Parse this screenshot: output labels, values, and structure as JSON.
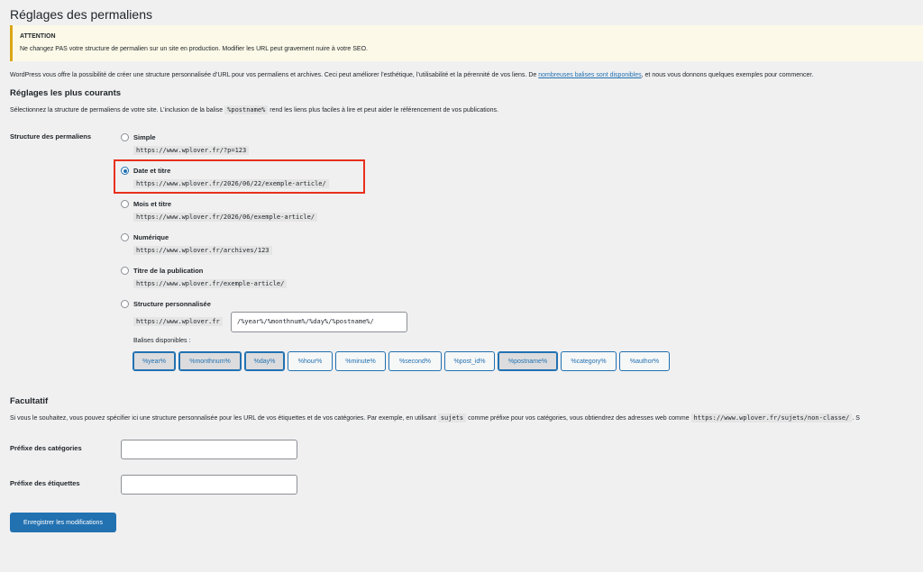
{
  "page": {
    "title": "Réglages des permaliens",
    "notice_title": "ATTENTION",
    "notice_text": "Ne changez PAS votre structure de permalien sur un site en production. Modifier les URL peut gravement nuire à votre SEO.",
    "intro_before": "WordPress vous offre la possibilité de créer une structure personnalisée d’URL pour vos permaliens et archives. Ceci peut améliorer l’esthétique, l’utilisabilité et la pérennité de vos liens. De ",
    "intro_link": "nombreuses balises sont disponibles",
    "intro_after": ", et nous vous donnons quelques exemples pour commencer."
  },
  "common": {
    "heading": "Réglages les plus courants",
    "desc_before": "Sélectionnez la structure de permaliens de votre site. L’inclusion de la balise ",
    "desc_code": "%postname%",
    "desc_after": " rend les liens plus faciles à lire et peut aider le référencement de vos publications.",
    "structure_label": "Structure des permaliens",
    "options": [
      {
        "label": "Simple",
        "example": "https://www.wplover.fr/?p=123"
      },
      {
        "label": "Date et titre",
        "example": "https://www.wplover.fr/2026/06/22/exemple-article/"
      },
      {
        "label": "Mois et titre",
        "example": "https://www.wplover.fr/2026/06/exemple-article/"
      },
      {
        "label": "Numérique",
        "example": "https://www.wplover.fr/archives/123"
      },
      {
        "label": "Titre de la publication",
        "example": "https://www.wplover.fr/exemple-article/"
      },
      {
        "label": "Structure personnalisée",
        "example": "https://www.wplover.fr"
      }
    ],
    "selected": "Date et titre",
    "custom_value": "/%year%/%monthnum%/%day%/%postname%/",
    "tags_label": "Balises disponibles :",
    "tags": [
      "%year%",
      "%monthnum%",
      "%day%",
      "%hour%",
      "%minute%",
      "%second%",
      "%post_id%",
      "%postname%",
      "%category%",
      "%author%"
    ],
    "active_tags": [
      "%year%",
      "%monthnum%",
      "%day%",
      "%postname%"
    ]
  },
  "optional": {
    "heading": "Facultatif",
    "desc_before": "Si vous le souhaitez, vous pouvez spécifier ici une structure personnalisée pour les URL de vos étiquettes et de vos catégories. Par exemple, en utilisant ",
    "desc_code1": "sujets",
    "desc_mid": " comme préfixe pour vos catégories, vous obtiendrez des adresses web comme ",
    "desc_code2": "https://www.wplover.fr/sujets/non-classe/",
    "desc_after": ". S",
    "category_label": "Préfixe des catégories",
    "category_value": "",
    "tag_label": "Préfixe des étiquettes",
    "tag_value": ""
  },
  "save_button": "Enregistrer les modifications",
  "colors": {
    "accent": "#2271b1",
    "highlight": "#e8301c",
    "notice_border": "#dba617"
  }
}
